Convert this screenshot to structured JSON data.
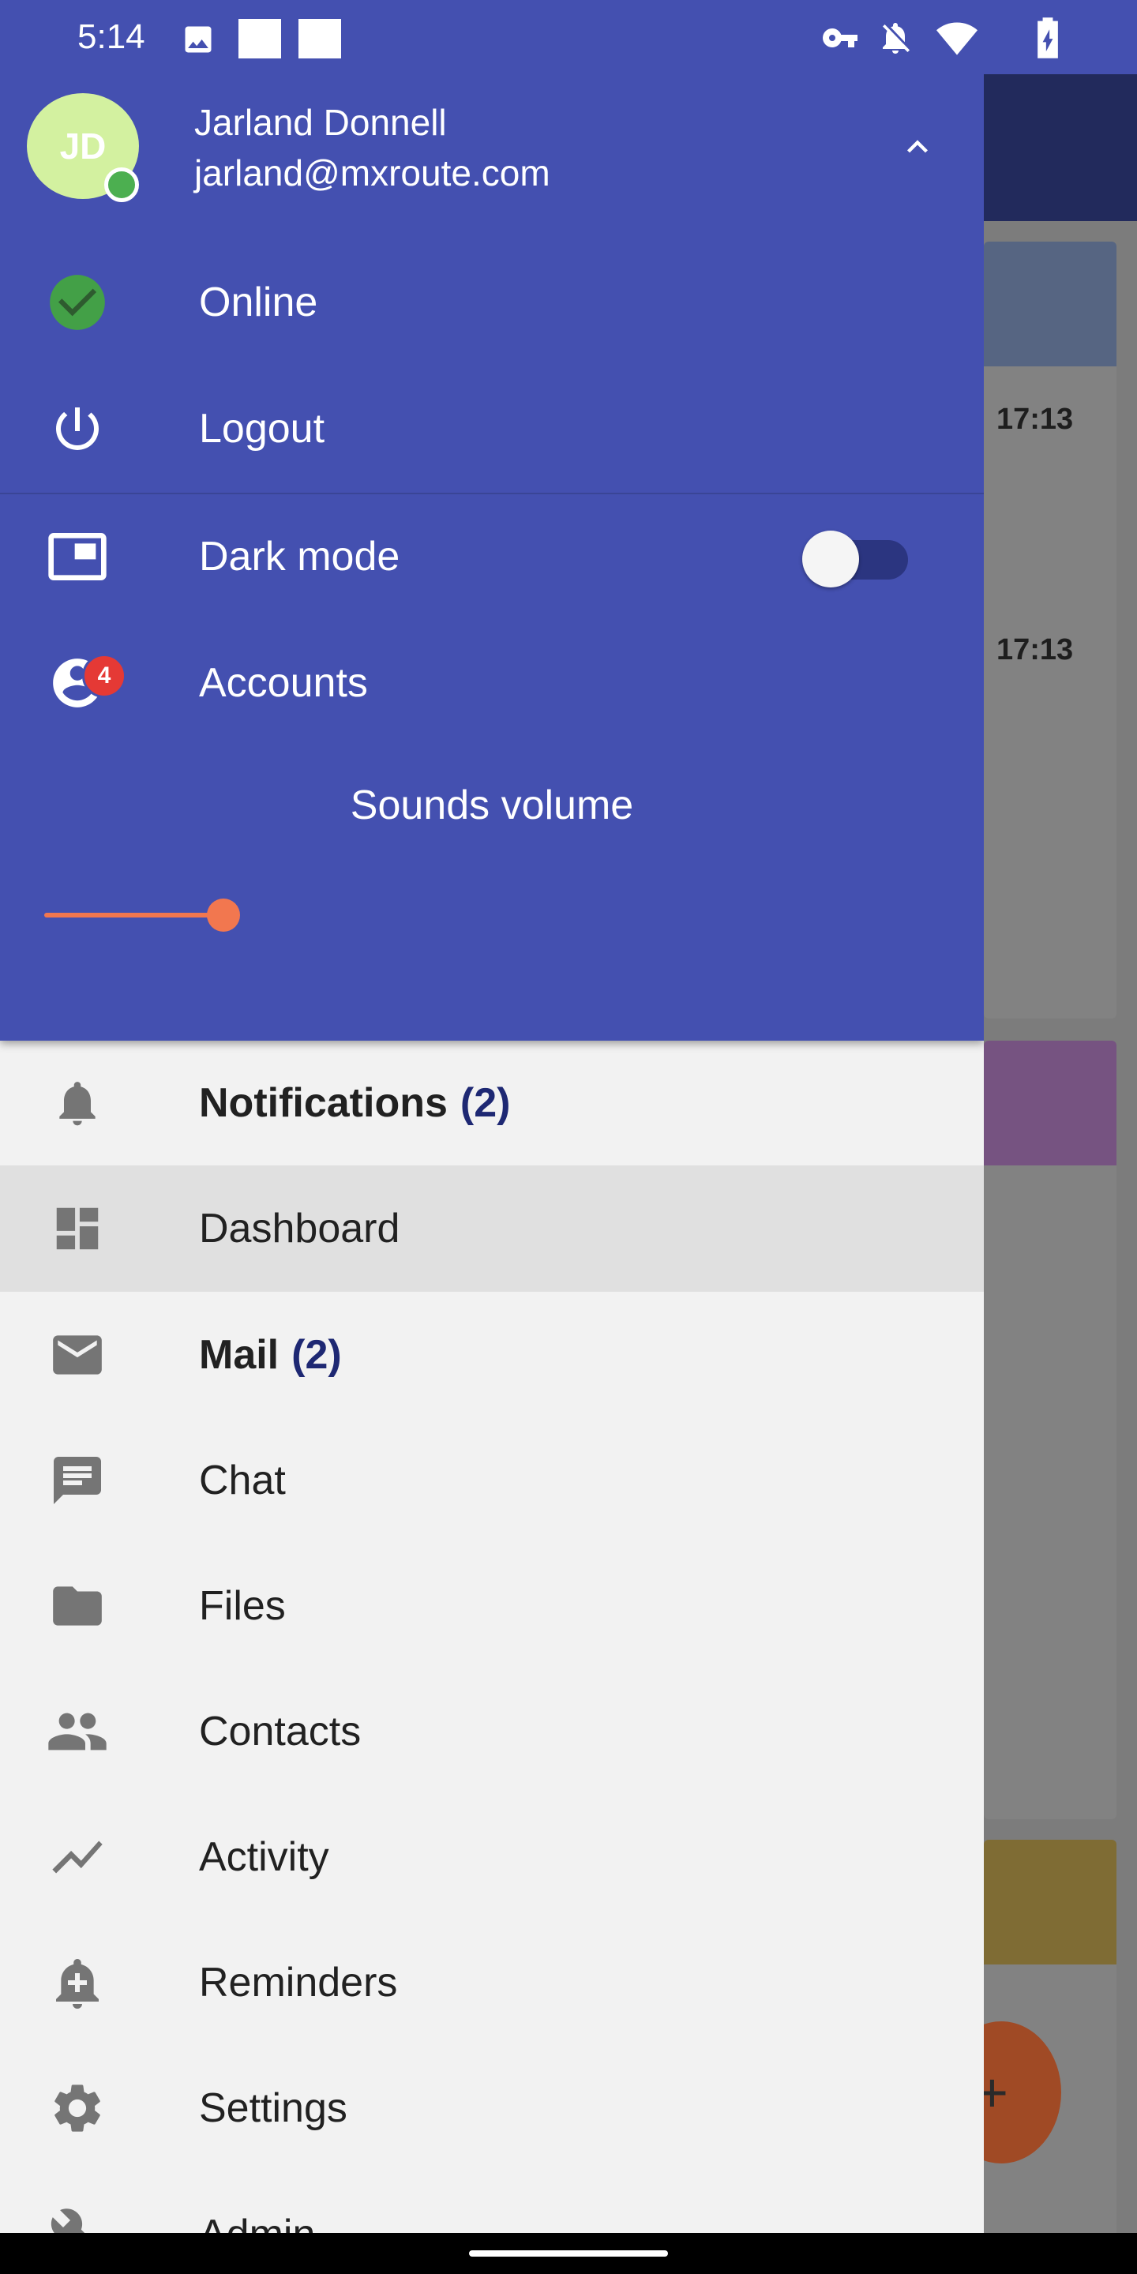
{
  "status_bar": {
    "time": "5:14",
    "icons": [
      "image-icon",
      "square-icon",
      "square-icon",
      "vpn-key-icon",
      "notifications-off-icon",
      "wifi-icon",
      "battery-charging-icon"
    ]
  },
  "background": {
    "times": [
      "17:13",
      "17:13"
    ],
    "fab_label": "+"
  },
  "drawer": {
    "avatar_initials": "JD",
    "user_name": "Jarland Donnell",
    "user_email": "jarland@mxroute.com",
    "status": {
      "label": "Online",
      "icon": "check-circle-icon"
    },
    "logout": {
      "label": "Logout",
      "icon": "power-icon"
    },
    "dark_mode": {
      "label": "Dark mode",
      "icon": "picture-in-picture-icon",
      "enabled": false
    },
    "accounts": {
      "label": "Accounts",
      "icon": "account-circle-icon",
      "badge": "4"
    },
    "sounds_volume": {
      "label": "Sounds volume",
      "value_fraction": 0.21
    },
    "nav": [
      {
        "label": "Notifications",
        "count": "(2)",
        "icon": "bell-icon",
        "bold": true,
        "active": false
      },
      {
        "label": "Dashboard",
        "count": "",
        "icon": "dashboard-icon",
        "bold": false,
        "active": true
      },
      {
        "label": "Mail",
        "count": "(2)",
        "icon": "mail-icon",
        "bold": true,
        "active": false
      },
      {
        "label": "Chat",
        "count": "",
        "icon": "chat-icon",
        "bold": false,
        "active": false
      },
      {
        "label": "Files",
        "count": "",
        "icon": "folder-icon",
        "bold": false,
        "active": false
      },
      {
        "label": "Contacts",
        "count": "",
        "icon": "people-icon",
        "bold": false,
        "active": false
      },
      {
        "label": "Activity",
        "count": "",
        "icon": "trending-icon",
        "bold": false,
        "active": false
      },
      {
        "label": "Reminders",
        "count": "",
        "icon": "alarm-add-icon",
        "bold": false,
        "active": false
      },
      {
        "label": "Settings",
        "count": "",
        "icon": "gear-icon",
        "bold": false,
        "active": false
      },
      {
        "label": "Admin",
        "count": "",
        "icon": "wrench-icon",
        "bold": false,
        "active": false
      }
    ]
  },
  "colors": {
    "header": "#4450b0",
    "accent": "#f2774f",
    "count": "#1e2873",
    "online": "#43a047",
    "badge": "#e53935"
  }
}
